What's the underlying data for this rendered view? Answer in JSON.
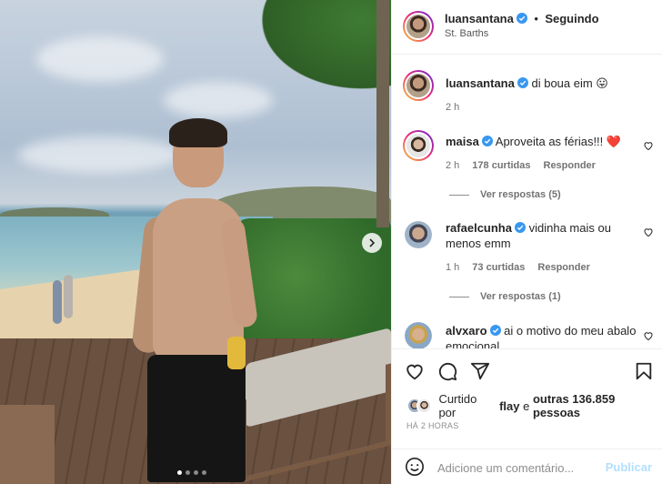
{
  "post": {
    "carousel": {
      "slide_count": 4,
      "active_index": 0
    }
  },
  "header": {
    "username": "luansantana",
    "separator": "•",
    "follow_status": "Seguindo",
    "location": "St. Barths"
  },
  "caption": {
    "username": "luansantana",
    "text": "di boua eim 😛",
    "time": "2 h"
  },
  "comments": [
    {
      "username": "maisa",
      "text": "Aproveita as férias!!! ❤️",
      "time": "2 h",
      "likes": "178 curtidas",
      "reply_label": "Responder",
      "view_replies": "Ver respostas (5)"
    },
    {
      "username": "rafaelcunha",
      "text_line1": "vidinha mais ou",
      "text_line2": "menos emm",
      "time": "1 h",
      "likes": "73 curtidas",
      "reply_label": "Responder",
      "view_replies": "Ver respostas (1)"
    },
    {
      "username": "alvxaro",
      "text_line1": "ai o motivo do meu abalo",
      "text_line2": "emocional"
    }
  ],
  "likes_summary": {
    "prefix": "Curtido por",
    "first_user": "flay",
    "middle": "e",
    "others": "outras 136.859 pessoas"
  },
  "timestamp": "HÁ 2 HORAS",
  "add_comment": {
    "placeholder": "Adicione um comentário...",
    "publish_label": "Publicar"
  },
  "colors": {
    "verified": "#3897f0",
    "heart": "#ed4956",
    "publish_disabled": "#b2dffc"
  },
  "icons": {
    "like": "heart-icon",
    "comment": "comment-icon",
    "share": "paper-plane-icon",
    "save": "bookmark-icon",
    "emoji": "smiley-icon",
    "next": "chevron-right-icon"
  }
}
